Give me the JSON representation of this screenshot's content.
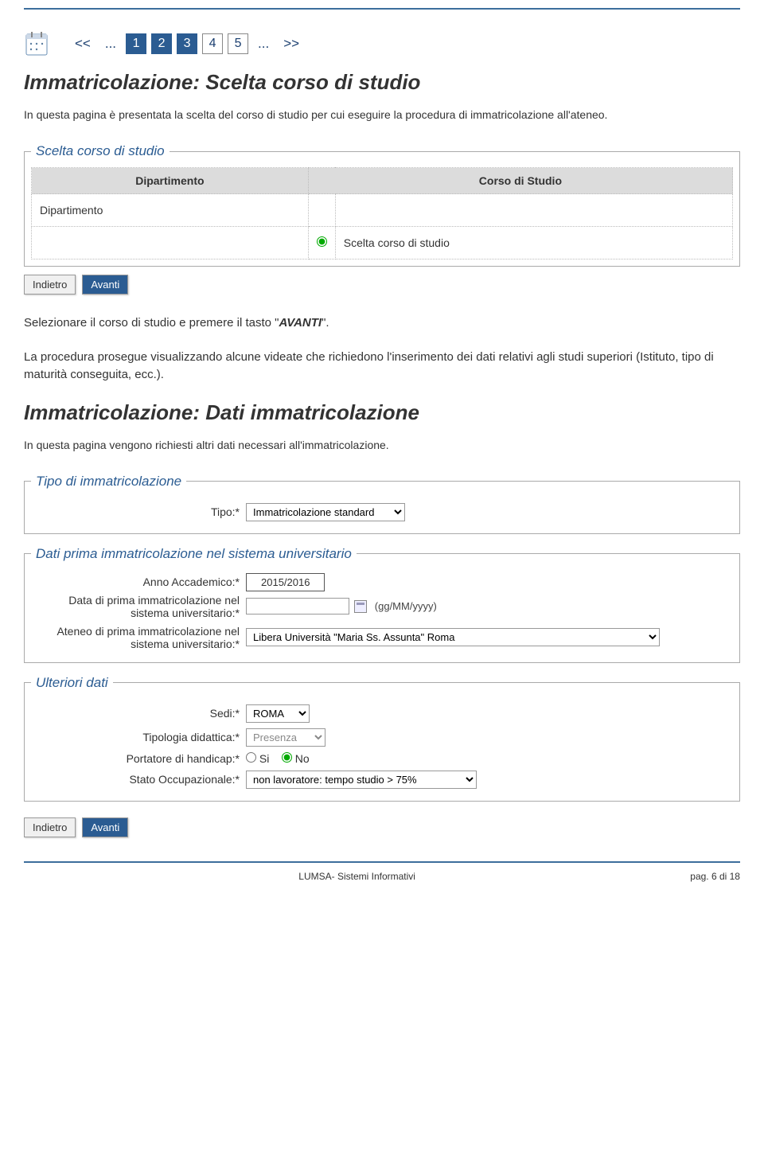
{
  "wizard1": {
    "prev": "<<",
    "dots": "...",
    "steps": [
      "1",
      "2",
      "3",
      "4",
      "5"
    ],
    "active": [
      0,
      1,
      2
    ],
    "next": ">>"
  },
  "section1": {
    "title": "Immatricolazione: Scelta corso di studio",
    "intro": "In questa pagina è presentata la scelta del corso di studio per cui eseguire la procedura di immatricolazione all'ateneo.",
    "legend": "Scelta corso di studio",
    "th1": "Dipartimento",
    "th2": "Corso di Studio",
    "row1_dip": "Dipartimento",
    "row2_corso": "Scelta corso di studio",
    "btn_back": "Indietro",
    "btn_next": "Avanti"
  },
  "instr1": {
    "p1_a": "Selezionare il corso di studio e premere il tasto \"",
    "p1_b": "AVANTI",
    "p1_c": "\".",
    "p2": "La procedura prosegue visualizzando alcune videate che richiedono l'inserimento dei dati relativi agli studi superiori (Istituto, tipo di maturità conseguita, ecc.)."
  },
  "section2": {
    "title": "Immatricolazione: Dati immatricolazione",
    "intro": "In questa pagina vengono richiesti altri dati necessari all'immatricolazione.",
    "fs_tipo": {
      "legend": "Tipo di immatricolazione",
      "label": "Tipo:*",
      "value": "Immatricolazione standard"
    },
    "fs_dati": {
      "legend": "Dati prima immatricolazione nel sistema universitario",
      "anno_label": "Anno Accademico:*",
      "anno_value": "2015/2016",
      "data_label": "Data di prima immatricolazione nel sistema universitario:*",
      "data_hint": "(gg/MM/yyyy)",
      "ateneo_label": "Ateneo di prima immatricolazione nel sistema universitario:*",
      "ateneo_value": "Libera Università \"Maria Ss. Assunta\" Roma"
    },
    "fs_ult": {
      "legend": "Ulteriori dati",
      "sedi_label": "Sedi:*",
      "sedi_value": "ROMA",
      "tipod_label": "Tipologia didattica:*",
      "tipod_value": "Presenza",
      "hand_label": "Portatore di handicap:*",
      "hand_si": "Si",
      "hand_no": "No",
      "stato_label": "Stato Occupazionale:*",
      "stato_value": "non lavoratore: tempo studio > 75%"
    },
    "btn_back": "Indietro",
    "btn_next": "Avanti"
  },
  "footer": {
    "left": "LUMSA- Sistemi Informativi",
    "right": "pag. 6 di 18"
  }
}
